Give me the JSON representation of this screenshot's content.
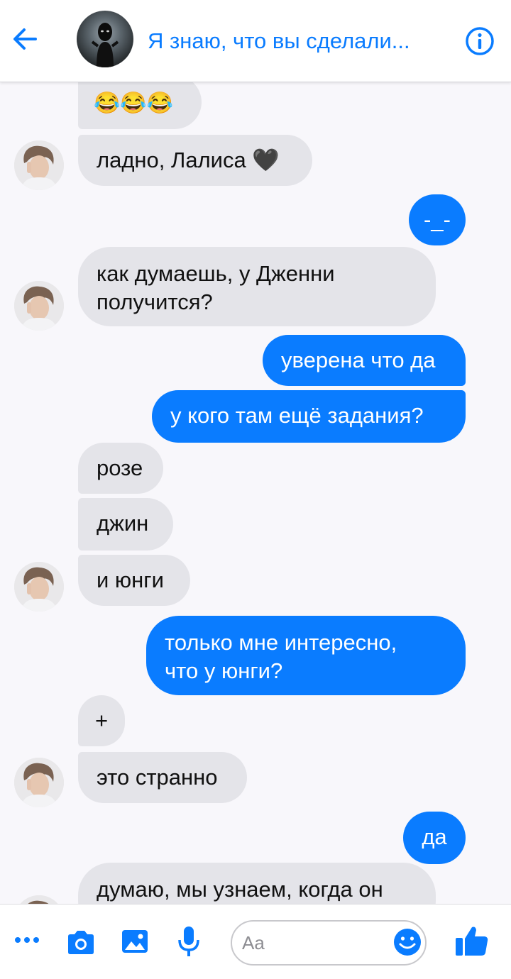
{
  "header": {
    "title": "Я знаю, что вы сделали...",
    "back_icon": "arrow-left-icon",
    "info_icon": "info-icon"
  },
  "messages": [
    {
      "side": "in",
      "text": "😂😂😂"
    },
    {
      "side": "in",
      "text": "ладно, Лалиса 🖤"
    },
    {
      "side": "out",
      "text": "-_-"
    },
    {
      "side": "in",
      "text_lines": [
        "как думаешь, у Дженни",
        "получится?"
      ]
    },
    {
      "side": "out",
      "text": "уверена что да"
    },
    {
      "side": "out",
      "text": "у кого там ещё задания?"
    },
    {
      "side": "in",
      "text": "розе"
    },
    {
      "side": "in",
      "text": "джин"
    },
    {
      "side": "in",
      "text": "и юнги"
    },
    {
      "side": "out",
      "text_lines": [
        "только мне интересно,",
        "что у юнги?"
      ]
    },
    {
      "side": "in",
      "text": "+"
    },
    {
      "side": "in",
      "text": "это странно"
    },
    {
      "side": "out",
      "text": "да"
    },
    {
      "side": "in",
      "text": "думаю, мы узнаем, когда он"
    }
  ],
  "composer": {
    "placeholder": "Aa",
    "icons": [
      "more-icon",
      "camera-icon",
      "image-icon",
      "microphone-icon",
      "emoji-icon",
      "thumbs-up-icon"
    ]
  },
  "colors": {
    "accent": "#0a7cff",
    "incoming_bubble": "#e4e4e9",
    "background": "#f8f7fb"
  }
}
